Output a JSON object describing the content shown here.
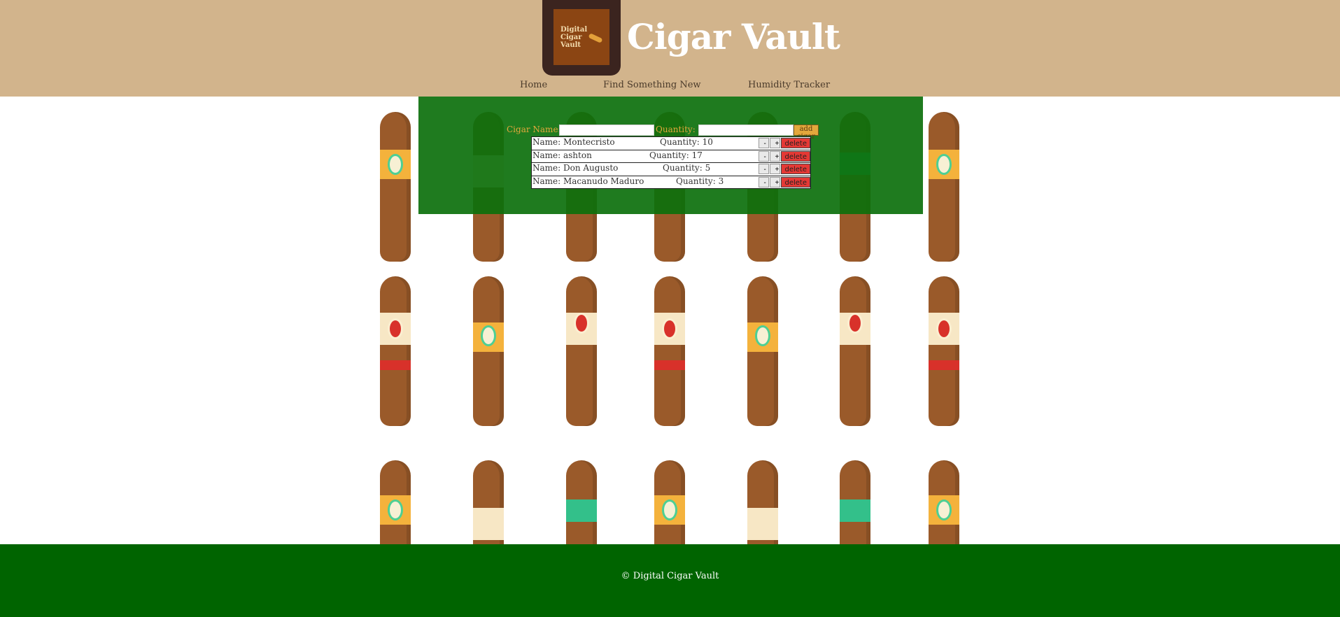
{
  "header": {
    "logo_text": "Digital Cigar Vault",
    "title": "Cigar Vault"
  },
  "nav": [
    {
      "label": "Home"
    },
    {
      "label": "Find Something New"
    },
    {
      "label": "Humidity Tracker"
    }
  ],
  "form": {
    "name_label": "Cigar Name:",
    "quantity_label": "Quantity:",
    "name_value": "",
    "quantity_value": "",
    "add_label": "add cigar"
  },
  "cigars": [
    {
      "name": "Name: Montecristo",
      "quantity": "Quantity: 10"
    },
    {
      "name": "Name: ashton",
      "quantity": "Quantity: 17"
    },
    {
      "name": "Name: Don Augusto",
      "quantity": "Quantity: 5"
    },
    {
      "name": "Name: Macanudo Maduro",
      "quantity": "Quantity: 3"
    }
  ],
  "row_buttons": {
    "minus": "-",
    "plus": "+",
    "delete": "delete"
  },
  "footer": {
    "text": "© Digital Cigar Vault"
  },
  "colors": {
    "header_bg": "#d2b48c",
    "panel_bg": "#0c700c",
    "footer_bg": "#006400",
    "accent": "#e3a83c",
    "delete": "#e53935"
  }
}
